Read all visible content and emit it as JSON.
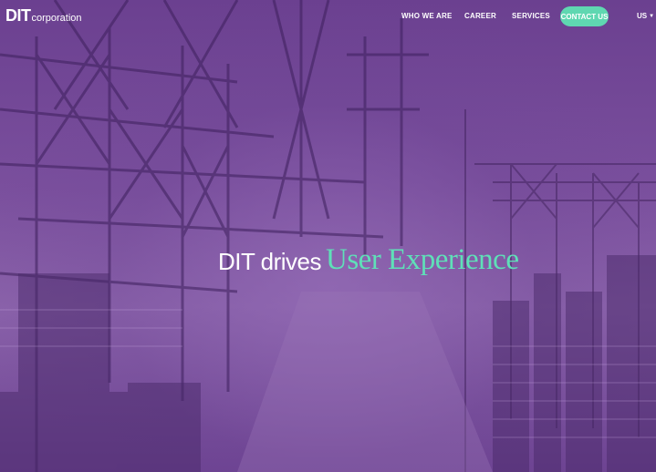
{
  "logo": {
    "main": "DIT",
    "sub": "corporation"
  },
  "nav": {
    "items": [
      {
        "label": "WHO WE ARE"
      },
      {
        "label": "CAREER"
      },
      {
        "label": "SERVICES"
      }
    ],
    "contact_label": "CONTACT US",
    "language": "US"
  },
  "hero": {
    "prefix": "DIT drives",
    "accent": "User Experience",
    "background": "port-cranes-photo"
  },
  "colors": {
    "overlay": "#6b4090",
    "accent": "#5fd7b1",
    "headline_accent": "#5fe0b8",
    "text": "#ffffff"
  }
}
